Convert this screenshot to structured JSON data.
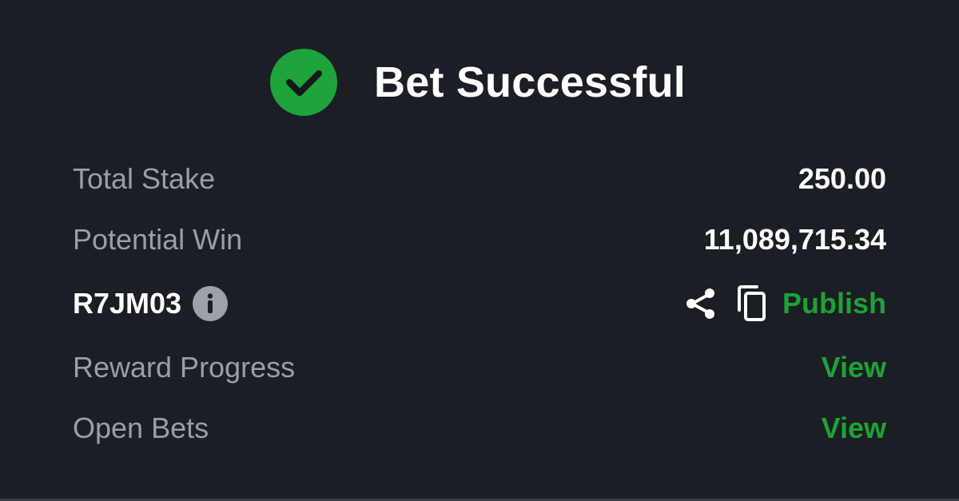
{
  "colors": {
    "background": "#1b1e24",
    "success_green": "#1fa33b",
    "link_green": "#1ea236",
    "label_gray": "#9a9ea8",
    "info_icon_bg": "#9ea1aa"
  },
  "header": {
    "icon": "checkmark-circle-icon",
    "title": "Bet Successful"
  },
  "summary": {
    "total_stake": {
      "label": "Total Stake",
      "value": "250.00"
    },
    "potential_win": {
      "label": "Potential Win",
      "value": "11,089,715.34"
    },
    "booking": {
      "code": "R7JM03",
      "info_icon": "info-icon",
      "share_icon": "share-icon",
      "copy_icon": "copy-icon",
      "publish_label": "Publish"
    },
    "reward_progress": {
      "label": "Reward Progress",
      "link": "View"
    },
    "open_bets": {
      "label": "Open Bets",
      "link": "View"
    }
  }
}
